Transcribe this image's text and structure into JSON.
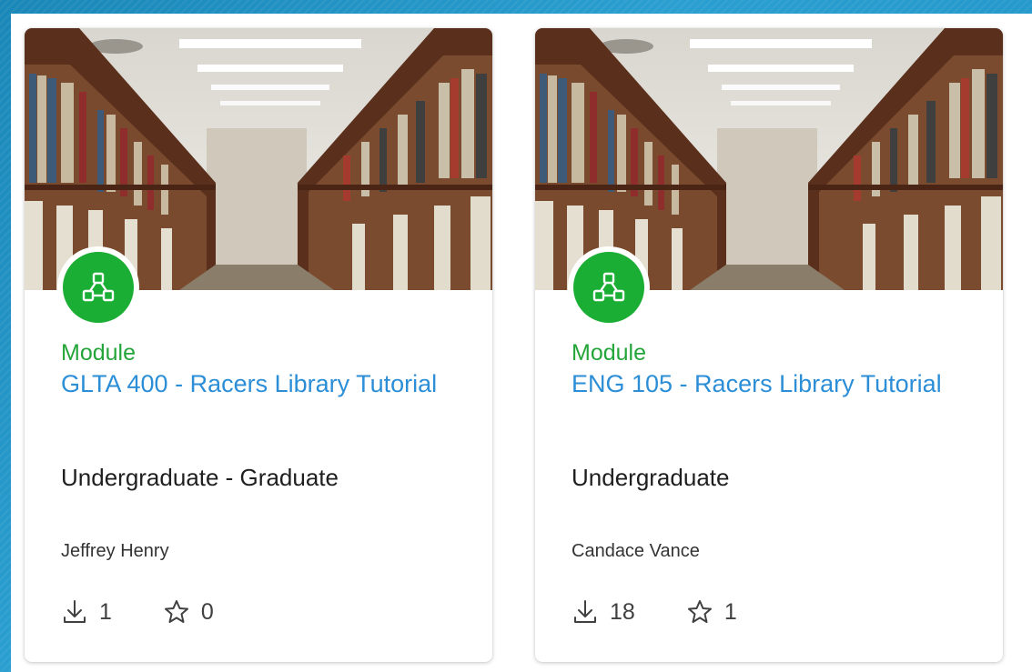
{
  "colors": {
    "accent_green": "#1aae34",
    "link_blue": "#2b8ed6",
    "module_green": "#24a53a"
  },
  "cards": [
    {
      "type_label": "Module",
      "title": "GLTA 400 - Racers Library Tutorial",
      "level": "Undergraduate - Graduate",
      "author": "Jeffrey Henry",
      "downloads": "1",
      "favorites": "0",
      "badge_icon": "module-network-icon",
      "image": "library-bookshelves-image"
    },
    {
      "type_label": "Module",
      "title": "ENG 105 - Racers Library Tutorial",
      "level": "Undergraduate",
      "author": "Candace Vance",
      "downloads": "18",
      "favorites": "1",
      "badge_icon": "module-network-icon",
      "image": "library-bookshelves-image"
    }
  ]
}
